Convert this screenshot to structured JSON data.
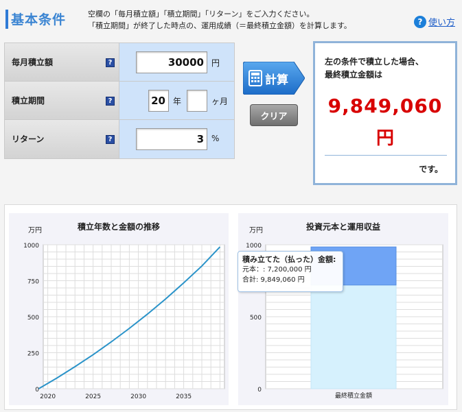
{
  "header": {
    "title": "基本条件",
    "desc_line1": "空欄の「毎月積立額」「積立期間」「リターン」をご入力ください。",
    "desc_line2": "「積立期間」が終了した時点の、運用成績（＝最終積立金額）を計算します。",
    "help_label": "使い方"
  },
  "form": {
    "monthly": {
      "label": "毎月積立額",
      "value": "30000",
      "unit": "円"
    },
    "period": {
      "label": "積立期間",
      "years_value": "20",
      "years_unit": "年",
      "months_value": "",
      "months_unit": "ヶ月"
    },
    "return": {
      "label": "リターン",
      "value": "3",
      "unit": "%"
    },
    "help_glyph": "?"
  },
  "buttons": {
    "calc_label": "計算",
    "clear_label": "クリア"
  },
  "result": {
    "line1": "左の条件で積立した場合、",
    "line2": "最終積立金額は",
    "amount": "9,849,060",
    "yen": "円",
    "desu": "です。"
  },
  "colors": {
    "accent": "#2f7bd6",
    "result_red": "#d80000",
    "line": "#2a93c9",
    "bar_principal": "#d6f1fd",
    "bar_gain": "#6fa4f5"
  },
  "chart_data": [
    {
      "type": "line",
      "title": "積立年数と金額の推移",
      "ylabel": "万円",
      "x": [
        2019,
        2021,
        2023,
        2025,
        2027,
        2029,
        2031,
        2033,
        2035,
        2037,
        2039
      ],
      "series": [
        {
          "values": [
            0,
            74,
            153,
            236,
            325,
            419,
            518,
            623,
            735,
            852,
            985
          ]
        }
      ],
      "xticks": [
        "2020",
        "2025",
        "2030",
        "2035"
      ],
      "yticks": [
        "0",
        "250",
        "500",
        "750",
        "1000"
      ],
      "xlim": [
        2019.5,
        2039.5
      ],
      "ylim": [
        0,
        1000
      ],
      "grid": true
    },
    {
      "type": "bar",
      "title": "投資元本と運用収益",
      "ylabel": "万円",
      "categories": [
        "最終積立金額"
      ],
      "series": [
        {
          "values": [
            720
          ]
        },
        {
          "values": [
            264.906
          ]
        }
      ],
      "yticks": [
        "0",
        "500",
        "1000"
      ],
      "ylim": [
        0,
        1000
      ],
      "grid": true,
      "tooltip": {
        "title": "積み立てた（払った）金額:",
        "line1": "元本：: 7,200,000 円",
        "line2": "合計: 9,849,060 円"
      }
    }
  ]
}
